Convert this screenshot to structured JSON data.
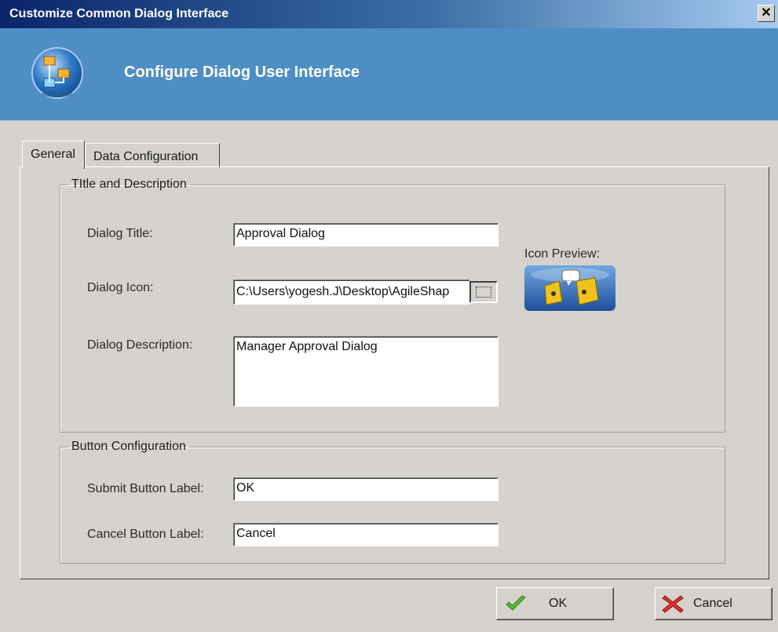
{
  "window": {
    "title": "Customize Common Dialog Interface",
    "close_glyph": "✕"
  },
  "header": {
    "heading": "Configure Dialog User Interface",
    "logo_icon": "dialog-config-icon"
  },
  "tabs": [
    {
      "label": "General",
      "active": true
    },
    {
      "label": "Data Configuration",
      "active": false
    }
  ],
  "title_group": {
    "legend": "TItle and Description",
    "dialog_title_label": "Dialog Title:",
    "dialog_title_value": "Approval Dialog",
    "dialog_icon_label": "Dialog Icon:",
    "dialog_icon_value": "C:\\Users\\yogesh.J\\Desktop\\AgileShap",
    "icon_preview_label": "Icon Preview:",
    "dialog_description_label": "Dialog Description:",
    "dialog_description_value": "Manager Approval Dialog"
  },
  "button_group": {
    "legend": "Button Configuration",
    "submit_label": "Submit Button Label:",
    "submit_value": "OK",
    "cancel_label": "Cancel Button Label:",
    "cancel_value": "Cancel"
  },
  "footer": {
    "ok": "OK",
    "cancel": "Cancel"
  },
  "colors": {
    "banner": "#4f8ec4",
    "titlebar": "#0a246a",
    "dialog_bg": "#d6d3ce"
  }
}
